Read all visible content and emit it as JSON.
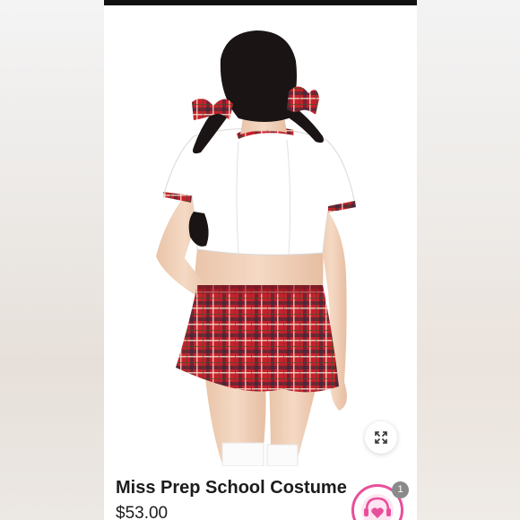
{
  "product": {
    "title": "Miss Prep School Costume",
    "price": "$53.00",
    "image_alt": "Model wearing a white crop top with plaid trim and a red plaid pleated mini skirt, with plaid hair bows"
  },
  "icons": {
    "expand": "expand-arrows-icon",
    "help": "heart-headset-icon"
  },
  "notification": {
    "count": "1"
  },
  "colors": {
    "accent": "#e84f9a",
    "plaid_red": "#c8202c",
    "text": "#1c1c1c",
    "badge": "#8a8a8a"
  }
}
